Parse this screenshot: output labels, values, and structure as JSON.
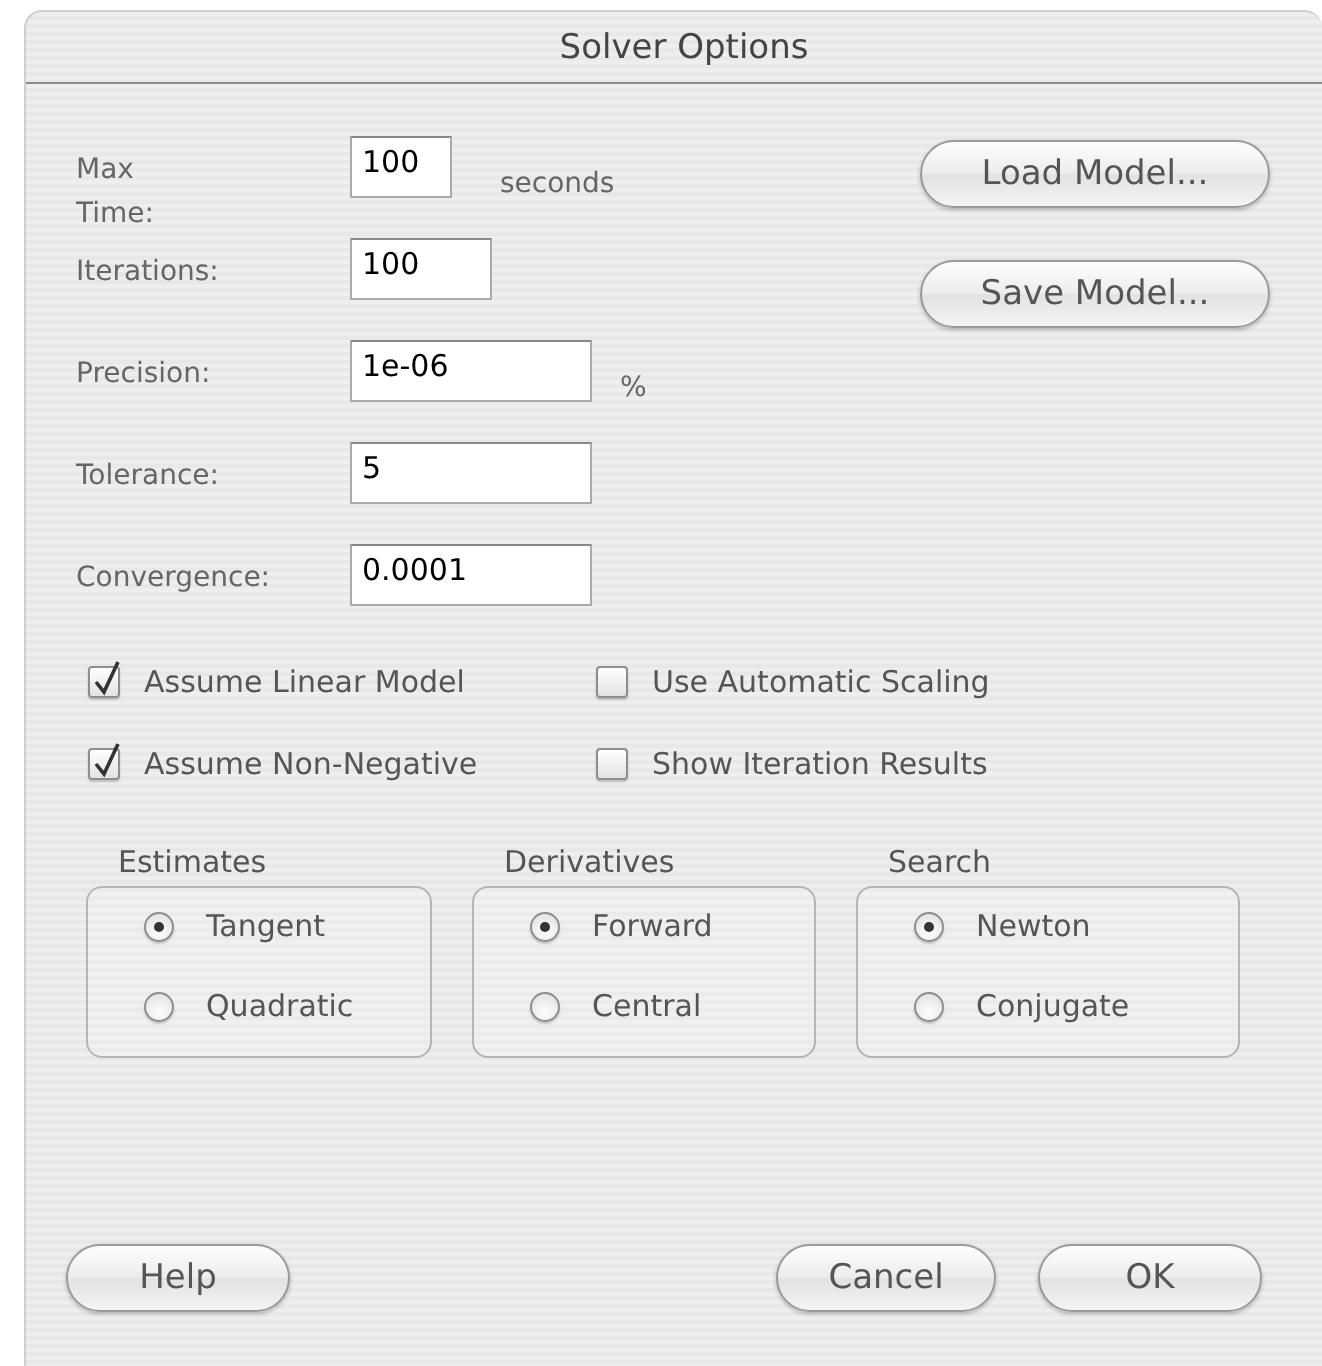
{
  "window": {
    "title": "Solver Options"
  },
  "fields": [
    {
      "label": "Max Time:",
      "value": "100",
      "unit": "seconds"
    },
    {
      "label": "Iterations:",
      "value": "100"
    },
    {
      "label": "Precision:",
      "value": "1e-06",
      "unit": "%"
    },
    {
      "label": "Tolerance:",
      "value": "5"
    },
    {
      "label": "Convergence:",
      "value": "0.0001"
    }
  ],
  "side_buttons": [
    "Load Model...",
    "Save Model..."
  ],
  "checkboxes": [
    {
      "label": "Assume Linear Model",
      "checked": true
    },
    {
      "label": "Use Automatic Scaling",
      "checked": false
    },
    {
      "label": "Assume Non-Negative",
      "checked": true
    },
    {
      "label": "Show Iteration Results",
      "checked": false
    }
  ],
  "groups": [
    {
      "title": "Estimates",
      "options": [
        {
          "label": "Tangent",
          "selected": true
        },
        {
          "label": "Quadratic",
          "selected": false
        }
      ]
    },
    {
      "title": "Derivatives",
      "options": [
        {
          "label": "Forward",
          "selected": true
        },
        {
          "label": "Central",
          "selected": false
        }
      ]
    },
    {
      "title": "Search",
      "options": [
        {
          "label": "Newton",
          "selected": true
        },
        {
          "label": "Conjugate",
          "selected": false
        }
      ]
    }
  ],
  "footer_buttons": {
    "help": "Help",
    "cancel": "Cancel",
    "ok": "OK"
  }
}
